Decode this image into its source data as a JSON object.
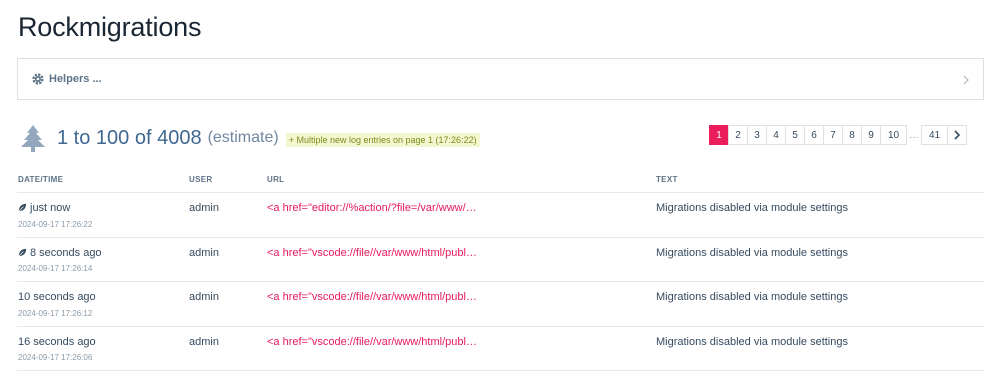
{
  "page": {
    "title": "Rockmigrations"
  },
  "helpers": {
    "label": "Helpers ..."
  },
  "summary": {
    "count_text": "1 to 100 of 4008",
    "estimate": "(estimate)",
    "note": "+ Multiple new log entries on page 1 (17:26:22)"
  },
  "pagination": {
    "pages": [
      "1",
      "2",
      "3",
      "4",
      "5",
      "6",
      "7",
      "8",
      "9",
      "10"
    ],
    "ellipsis": "…",
    "last": "41",
    "current": "1"
  },
  "table": {
    "headers": {
      "datetime": "DATE/TIME",
      "user": "USER",
      "url": "URL",
      "text": "TEXT"
    },
    "rows": [
      {
        "relative": "just now",
        "date": "2024-09-17 17:26:22",
        "user": "admin",
        "url": "<a href=\"editor://%action/?file=/var/www/…",
        "text": "Migrations disabled via module settings",
        "icon": "leaf-icon"
      },
      {
        "relative": "8 seconds ago",
        "date": "2024-09-17 17:26:14",
        "user": "admin",
        "url": "<a href=\"vscode://file//var/www/html/publ…",
        "text": "Migrations disabled via module settings",
        "icon": "leaf-icon"
      },
      {
        "relative": "10 seconds ago",
        "date": "2024-09-17 17:26:12",
        "user": "admin",
        "url": "<a href=\"vscode://file//var/www/html/publ…",
        "text": "Migrations disabled via module settings"
      },
      {
        "relative": "16 seconds ago",
        "date": "2024-09-17 17:26:06",
        "user": "admin",
        "url": "<a href=\"vscode://file//var/www/html/publ…",
        "text": "Migrations disabled via module settings"
      }
    ]
  },
  "colors": {
    "accent": "#eb1d5d",
    "link": "#e8195a",
    "count": "#3f6891"
  }
}
